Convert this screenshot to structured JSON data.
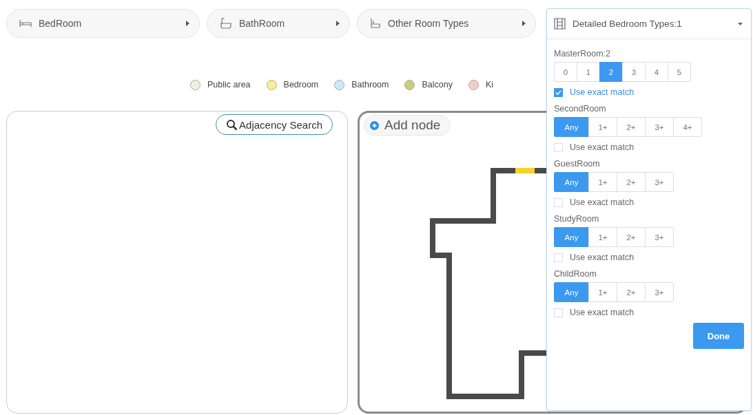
{
  "dropdowns": [
    {
      "label": "BedRoom",
      "kind": "bed"
    },
    {
      "label": "BathRoom",
      "kind": "bath"
    },
    {
      "label": "Other Room Types",
      "kind": "chair"
    }
  ],
  "legend": [
    {
      "label": "Public area",
      "color": "#f3efdf"
    },
    {
      "label": "Bedroom",
      "color": "#fbee8d"
    },
    {
      "label": "Bathroom",
      "color": "#c9e9f9"
    },
    {
      "label": "Balcony",
      "color": "#c8cf78"
    },
    {
      "label": "Ki",
      "color": "#f2cfc6"
    }
  ],
  "adjacency_panel": {
    "search_button": "Adjacency Search"
  },
  "plan_canvas": {
    "add_node_button": "Add node"
  },
  "bedroom_panel": {
    "title": "Detailed Bedroom Types:1",
    "groups": [
      {
        "label": "MasterRoom:2",
        "options": [
          {
            "label": "0",
            "selected": false
          },
          {
            "label": "1",
            "selected": false
          },
          {
            "label": "2",
            "selected": true
          },
          {
            "label": "3",
            "selected": false
          },
          {
            "label": "4",
            "selected": false
          },
          {
            "label": "5",
            "selected": false
          }
        ],
        "exact_match": {
          "label": "Use exact match",
          "checked": true
        }
      },
      {
        "label": "SecondRoom",
        "options": [
          {
            "label": "Any",
            "selected": true
          },
          {
            "label": "1+",
            "selected": false
          },
          {
            "label": "2+",
            "selected": false
          },
          {
            "label": "3+",
            "selected": false
          },
          {
            "label": "4+",
            "selected": false
          }
        ],
        "exact_match": {
          "label": "Use exact match",
          "checked": false
        }
      },
      {
        "label": "GuestRoom",
        "options": [
          {
            "label": "Any",
            "selected": true
          },
          {
            "label": "1+",
            "selected": false
          },
          {
            "label": "2+",
            "selected": false
          },
          {
            "label": "3+",
            "selected": false
          }
        ],
        "exact_match": {
          "label": "Use exact match",
          "checked": false
        }
      },
      {
        "label": "StudyRoom",
        "options": [
          {
            "label": "Any",
            "selected": true
          },
          {
            "label": "1+",
            "selected": false
          },
          {
            "label": "2+",
            "selected": false
          },
          {
            "label": "3+",
            "selected": false
          }
        ],
        "exact_match": {
          "label": "Use exact match",
          "checked": false
        }
      },
      {
        "label": "ChildRoom",
        "options": [
          {
            "label": "Any",
            "selected": true
          },
          {
            "label": "1+",
            "selected": false
          },
          {
            "label": "2+",
            "selected": false
          },
          {
            "label": "3+",
            "selected": false
          }
        ],
        "exact_match": {
          "label": "Use exact match",
          "checked": false
        }
      }
    ],
    "done_button": "Done"
  }
}
